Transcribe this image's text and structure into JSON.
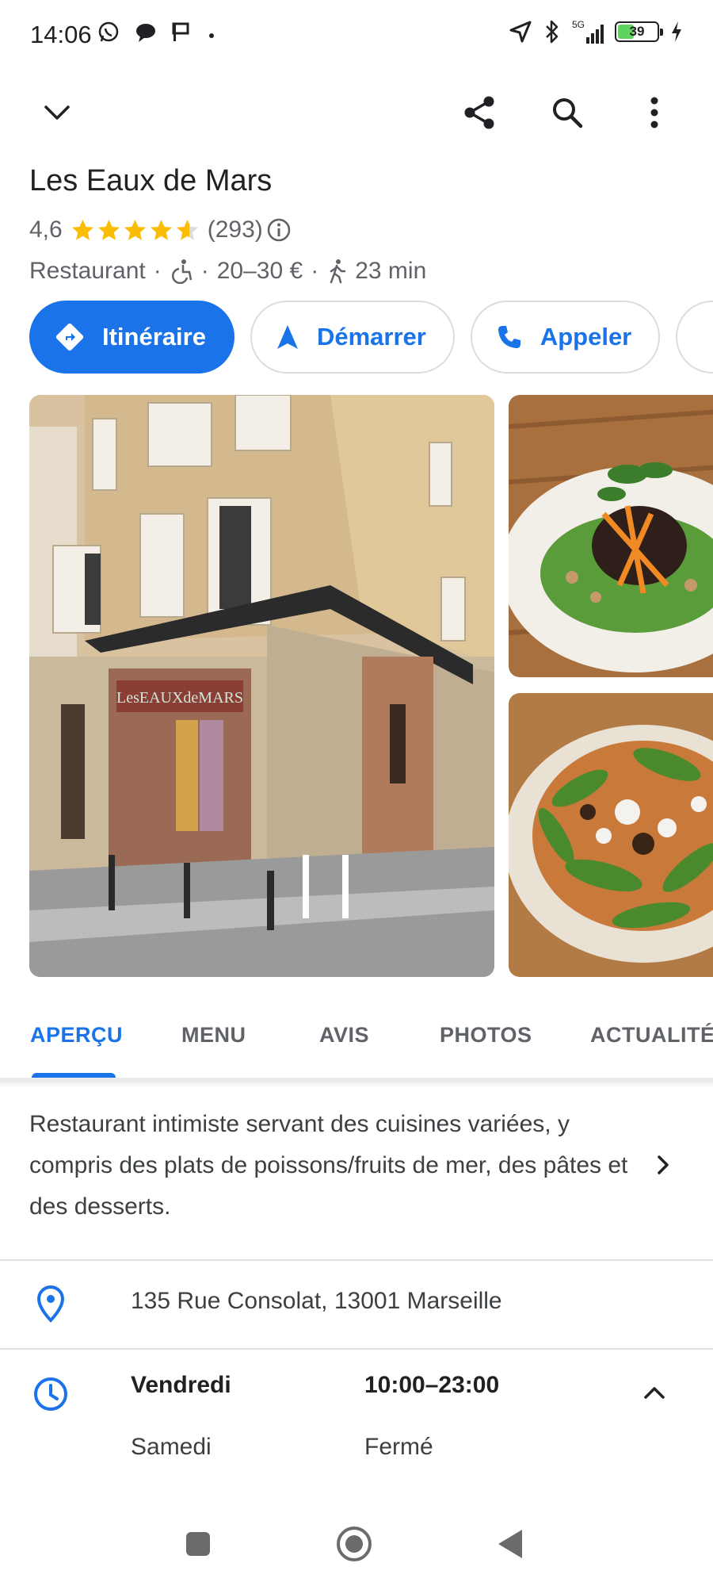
{
  "status_bar": {
    "time": "14:06",
    "battery_level": "39",
    "network_label": "5G",
    "left_icons": [
      "whatsapp-icon",
      "chat-bubble-icon",
      "flag-icon",
      "dot"
    ],
    "right_icons": [
      "location-arrow-icon",
      "bluetooth-icon",
      "signal-icon",
      "battery-icon",
      "charging-bolt-icon"
    ]
  },
  "top_bar": {
    "icons": [
      "chevron-down-icon",
      "share-icon",
      "search-icon",
      "more-vert-icon"
    ]
  },
  "place": {
    "name": "Les Eaux de Mars",
    "rating": "4,6",
    "rating_fraction": 0.92,
    "review_count": "(293)",
    "category": "Restaurant",
    "separator": "·",
    "price_range": "20–30 €",
    "walk_time": "23 min"
  },
  "actions": [
    {
      "label": "Itinéraire",
      "icon": "directions-icon",
      "primary": true
    },
    {
      "label": "Démarrer",
      "icon": "navigation-arrow-icon",
      "primary": false
    },
    {
      "label": "Appeler",
      "icon": "phone-icon",
      "primary": false
    }
  ],
  "photos": {
    "sign_text": "LesEAUXdeMARS"
  },
  "tabs": [
    {
      "label": "APERÇU",
      "active": true
    },
    {
      "label": "MENU",
      "active": false
    },
    {
      "label": "AVIS",
      "active": false
    },
    {
      "label": "PHOTOS",
      "active": false
    },
    {
      "label": "ACTUALITÉ",
      "active": false
    }
  ],
  "description": "Restaurant intimiste servant des cuisines variées, y compris des plats de poissons/fruits de mer, des pâtes et des desserts.",
  "address": "135 Rue Consolat, 13001 Marseille",
  "hours": [
    {
      "day": "Vendredi",
      "time": "10:00–23:00",
      "today": true
    },
    {
      "day": "Samedi",
      "time": "Fermé",
      "today": false
    }
  ],
  "colors": {
    "accent": "#1a73e8",
    "star": "#fbbc04",
    "text_secondary": "#5f6368"
  }
}
